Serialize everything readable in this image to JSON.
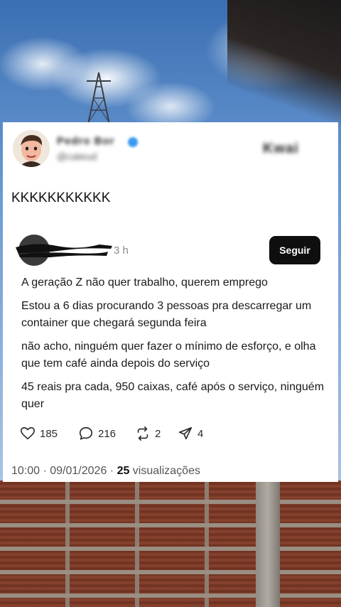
{
  "author": {
    "name": "Pedro Bor",
    "handle": "@cateud",
    "avatar_icon": "cartoon-face-avatar"
  },
  "brand": "Kwai",
  "post": {
    "text": "KKKKKKKKKKK"
  },
  "quoted_post": {
    "time": "3 h",
    "follow_label": "Seguir",
    "paragraphs": [
      "A geração Z não quer trabalho, querem emprego",
      "Estou a 6 dias procurando 3 pessoas pra descarregar um container que chegará segunda feira",
      "não acho, ninguém quer fazer o mínimo de esforço, e olha que tem café ainda depois do serviço",
      "45 reais pra cada, 950 caixas, café após o serviço, ninguém quer"
    ],
    "actions": {
      "likes": "185",
      "replies": "216",
      "reposts": "2",
      "shares": "4"
    }
  },
  "meta": {
    "time_date": "10:00 · 09/01/2026 · ",
    "views_count": "25",
    "views_label": " visualizações"
  }
}
